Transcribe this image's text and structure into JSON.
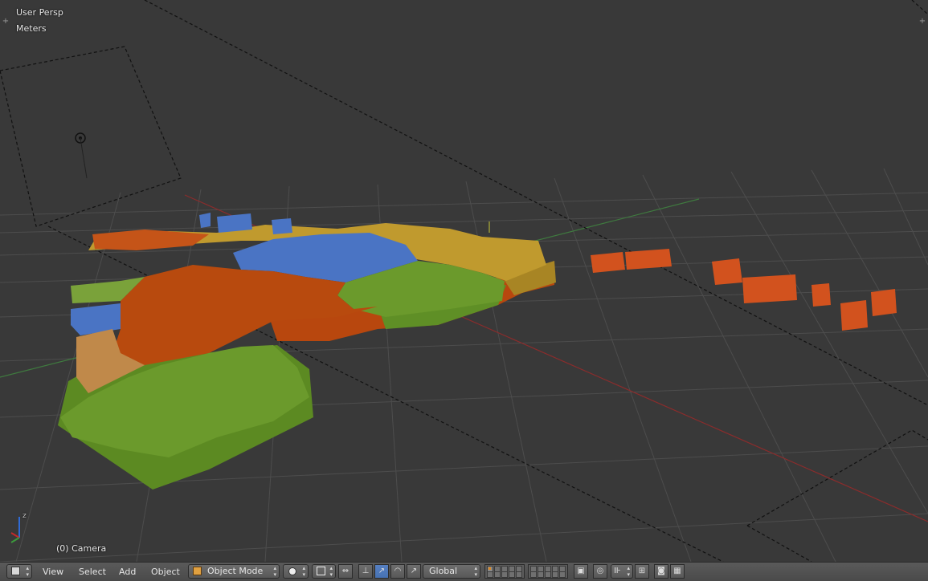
{
  "viewport": {
    "view_name": "User Persp",
    "units": "Meters",
    "active_object": "(0) Camera",
    "axis_labels": {
      "z": "z",
      "x": "x",
      "y": "y"
    },
    "colors": {
      "background": "#393939",
      "grid": "#4c4c4c",
      "x_axis": "#8a2c2c",
      "y_axis": "#3f7a3f",
      "region_orange": "#b84a0e",
      "region_green": "#6b9a2c",
      "region_blue": "#4a74c4",
      "region_gold": "#c09a2e",
      "region_tan": "#c0894a",
      "islands": "#d2521e"
    }
  },
  "header": {
    "editor_type_icon": "cube-icon",
    "menus": [
      "View",
      "Select",
      "Add",
      "Object"
    ],
    "mode": "Object Mode",
    "transform_orientation": "Global"
  }
}
